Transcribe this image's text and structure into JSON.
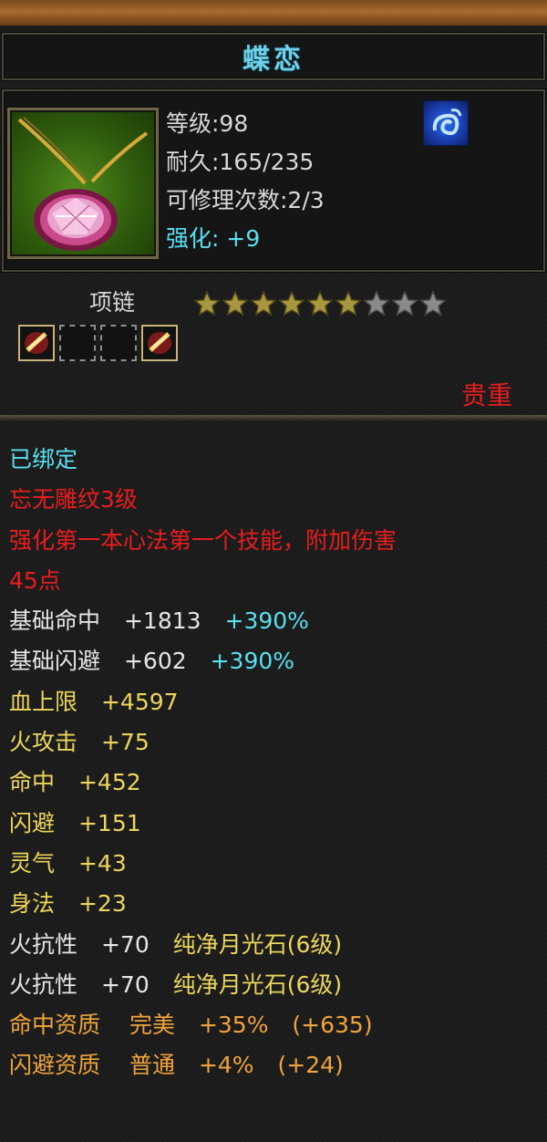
{
  "item": {
    "name": "蝶恋",
    "level_text": "等级:98",
    "durability_text": "耐久:165/235",
    "repairs_text": "可修理次数:2/3",
    "enhance_label": "强化:",
    "enhance_value": "+9",
    "type": "项链",
    "rarity": "贵重"
  },
  "stars": {
    "filled": 6,
    "total": 9
  },
  "sockets": [
    "gem",
    "empty",
    "empty",
    "gem"
  ],
  "details": {
    "bound": "已绑定",
    "engraving": "忘无雕纹3级",
    "effect_line1": "强化第一本心法第一个技能，附加伤害",
    "effect_line2": "45点",
    "base_hit_label": "基础命中",
    "base_hit_value": "+1813",
    "base_hit_pct": "+390%",
    "base_dodge_label": "基础闪避",
    "base_dodge_value": "+602",
    "base_dodge_pct": "+390%",
    "hp_label": "血上限",
    "hp_value": "+4597",
    "fire_atk_label": "火攻击",
    "fire_atk_value": "+75",
    "hit_label": "命中",
    "hit_value": "+452",
    "dodge_label": "闪避",
    "dodge_value": "+151",
    "spirit_label": "灵气",
    "spirit_value": "+43",
    "agility_label": "身法",
    "agility_value": "+23",
    "fire_res1_label": "火抗性",
    "fire_res1_value": "+70",
    "fire_res1_gem": "纯净月光石(6级)",
    "fire_res2_label": "火抗性",
    "fire_res2_value": "+70",
    "fire_res2_gem": "纯净月光石(6级)",
    "hit_quality_label": "命中资质",
    "hit_quality_grade": "完美",
    "hit_quality_value": "+35%",
    "hit_quality_bonus": "(+635)",
    "dodge_quality_label": "闪避资质",
    "dodge_quality_grade": "普通",
    "dodge_quality_value": "+4%",
    "dodge_quality_bonus": "(+24)"
  },
  "colors": {
    "title": "#6fd0ea",
    "cyan": "#58e0f0",
    "red": "#e81d1d",
    "yellow": "#ecd65a",
    "gold": "#f0a43b",
    "white": "#e6e6e6"
  }
}
